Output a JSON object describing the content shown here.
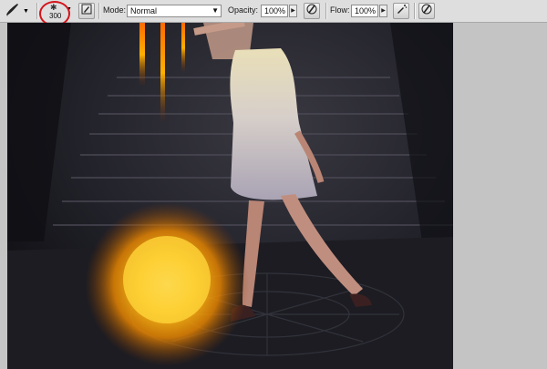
{
  "toolbar": {
    "tool_icon": "brush-icon",
    "brush_size": "300",
    "toggle_icon": "brush-panel-icon",
    "mode_label": "Mode:",
    "mode_value": "Normal",
    "opacity_label": "Opacity:",
    "opacity_value": "100%",
    "flow_label": "Flow:",
    "flow_value": "100%",
    "pressure_icon": "tablet-pressure-icon",
    "airbrush_icon": "airbrush-icon"
  },
  "colors": {
    "toolbar_bg": "#dedede",
    "workspace_bg": "#c4c4c4",
    "highlight_circle": "#d4141b",
    "glow": "#ffb000"
  }
}
